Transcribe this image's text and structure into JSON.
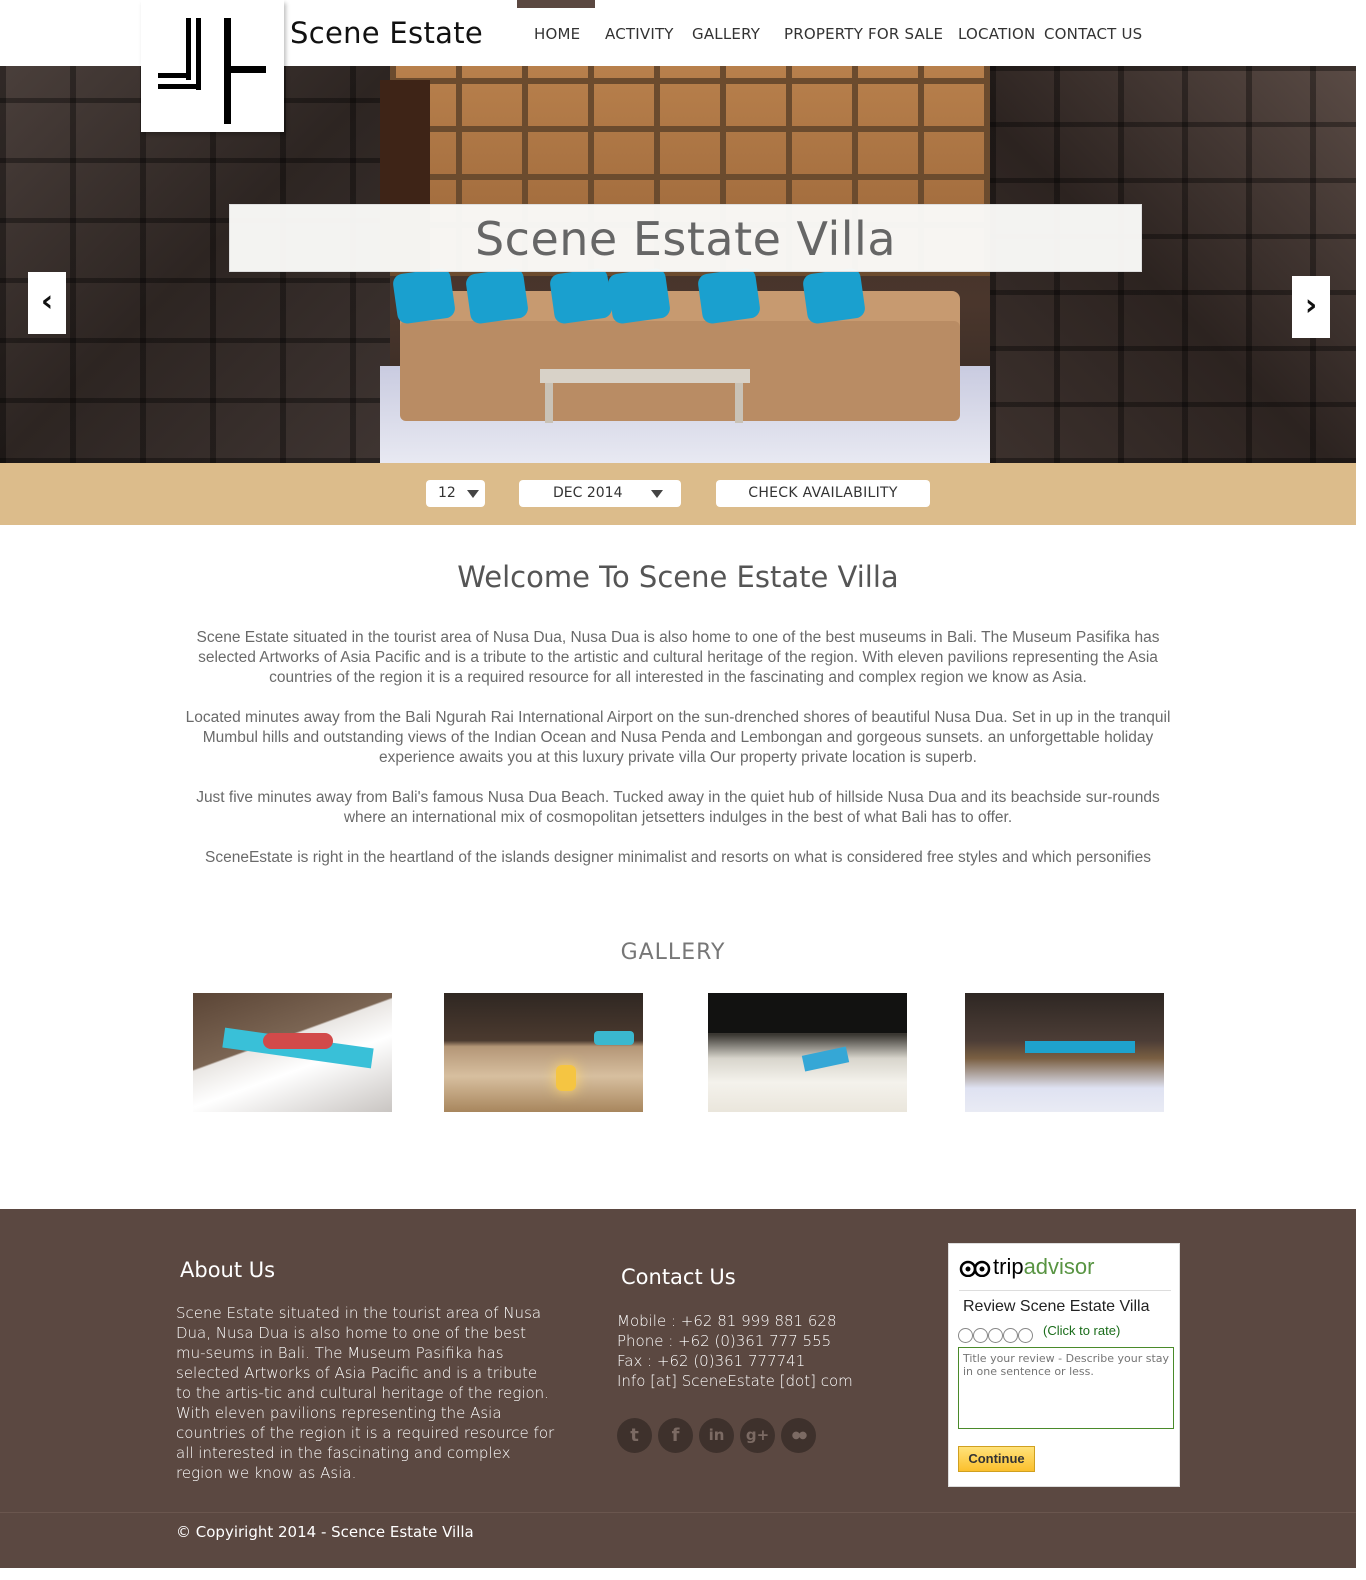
{
  "header": {
    "brand": "Scene Estate",
    "nav": [
      {
        "label": "HOME",
        "active": true
      },
      {
        "label": "ACTIVITY"
      },
      {
        "label": "GALLERY"
      },
      {
        "label": "PROPERTY FOR SALE"
      },
      {
        "label": "LOCATION"
      },
      {
        "label": "CONTACT US"
      }
    ]
  },
  "hero": {
    "title": "Scene Estate Villa",
    "prev_icon": "‹",
    "next_icon": "›"
  },
  "booking": {
    "day": "12",
    "month": "DEC 2014",
    "check_label": "CHECK AVAILABILITY"
  },
  "welcome": {
    "title": "Welcome To Scene Estate Villa",
    "paragraphs": [
      "Scene Estate situated in the tourist area of Nusa Dua, Nusa Dua is also home to one of the best museums in Bali. The Museum Pasifika has selected Artworks of Asia Pacific and is a tribute to the artistic and cultural heritage of the region. With eleven pavilions representing the Asia countries of the region it is a required resource for all interested in the fascinating and complex region we know as Asia.",
      "Located minutes away from the Bali Ngurah Rai International Airport on the sun-drenched shores of beautiful Nusa Dua. Set in up in the tranquil Mumbul hills and outstanding views of the Indian Ocean and Nusa Penda and Lembongan and gorgeous sunsets. an unforgettable holiday experience awaits you at this luxury private villa Our property private location is superb.",
      "Just five minutes away from Bali's famous Nusa Dua Beach. Tucked away in the quiet hub of hillside Nusa Dua and its beachside sur-rounds where an international mix of cosmopolitan jetsetters indulges in the best of what Bali has to offer.",
      "SceneEstate is right in the heartland of the islands designer minimalist and resorts on what is considered free styles and which personifies"
    ]
  },
  "gallery": {
    "title": "GALLERY"
  },
  "footer": {
    "about_title": "About Us",
    "about_text": "Scene Estate situated in the tourist area of Nusa Dua, Nusa Dua is also home to one of the best mu-seums in Bali. The Museum Pasifika has selected Artworks of Asia Pacific and is a tribute to the artis-tic and cultural heritage of the region. With eleven pavilions representing the Asia countries of the region it is a required resource for all interested in the fascinating and complex region we know as Asia.",
    "contact_title": "Contact Us",
    "contact_lines": [
      "Mobile : +62 81 999 881 628",
      "Phone : +62 (0)361 777 555",
      "Fax : +62 (0)361 777741",
      "Info [at] SceneEstate [dot] com"
    ],
    "social": [
      {
        "icon": "tumblr-icon",
        "glyph": "t"
      },
      {
        "icon": "facebook-icon",
        "glyph": "f"
      },
      {
        "icon": "linkedin-icon",
        "glyph": "in"
      },
      {
        "icon": "google-plus-icon",
        "glyph": "g+"
      },
      {
        "icon": "flickr-icon",
        "glyph": "●●"
      }
    ],
    "copyright": "© Copyiright 2014 - Scence Estate Villa"
  },
  "tripadvisor": {
    "logo_trip": "trip",
    "logo_advisor": "advisor",
    "review_title": "Review Scene Estate Villa",
    "click_to_rate": "(Click to rate)",
    "textarea_placeholder": "Title your review - Describe your stay in one sentence or less.",
    "continue_label": "Continue"
  },
  "colors": {
    "accent_brown": "#5b4841",
    "booking_bar": "#dcbc8b"
  }
}
